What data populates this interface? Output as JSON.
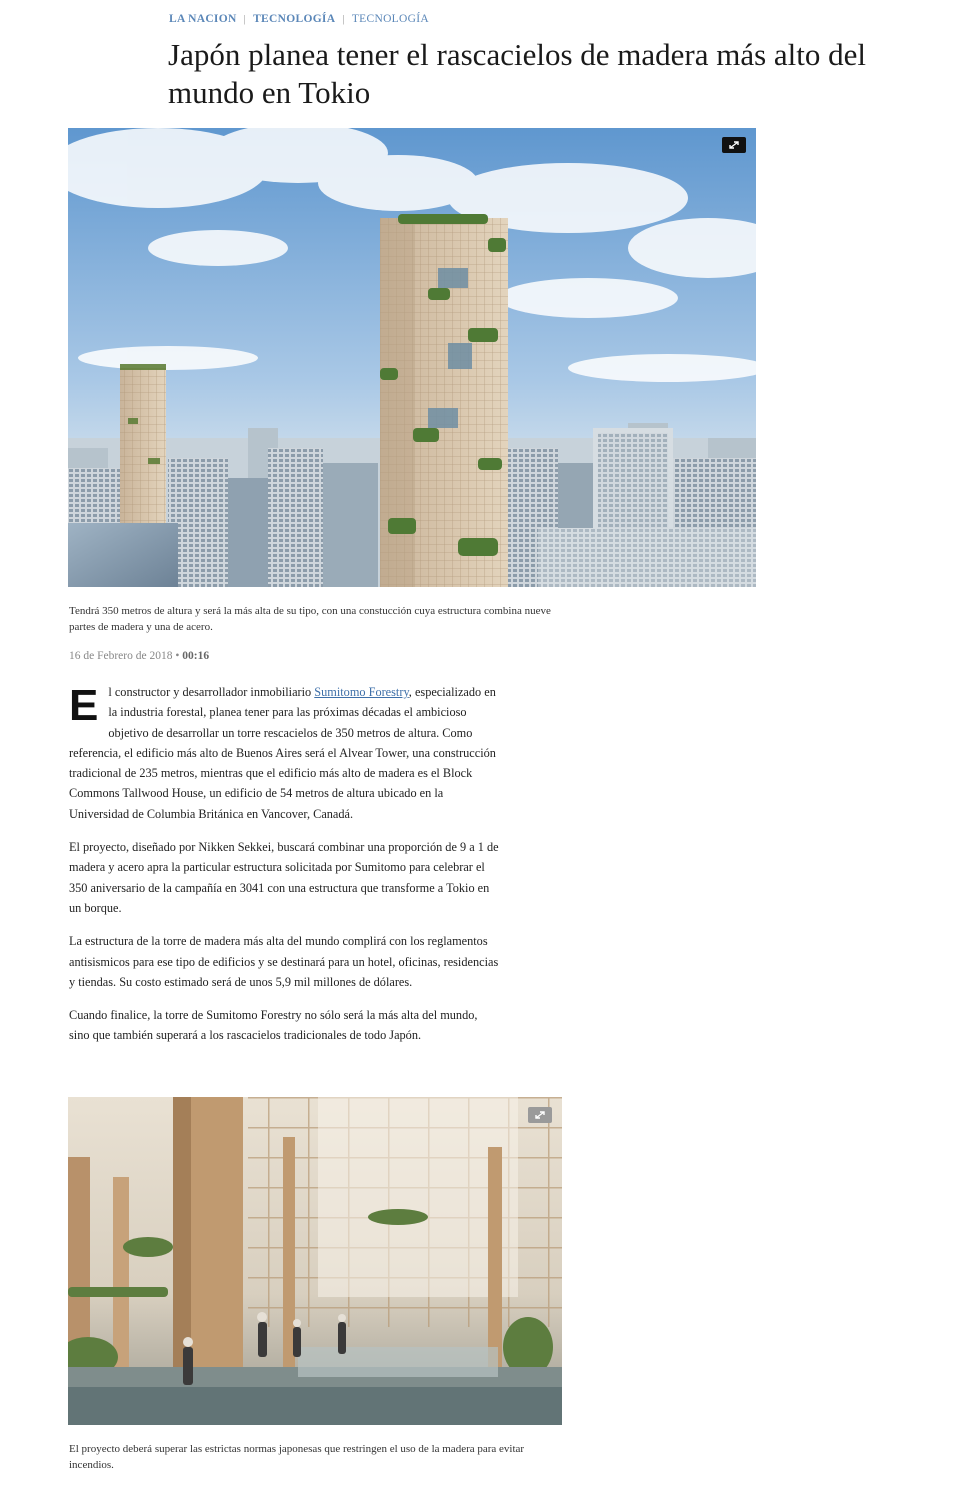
{
  "breadcrumb": {
    "site": "LA NACION",
    "section": "TECNOLOGÍA",
    "subsection": "Tecnología"
  },
  "article": {
    "title": "Japón planea tener el rascacielos de madera más alto del mundo en Tokio",
    "hero_caption": "Tendrá 350 metros de altura y será la más alta de su tipo, con una constucción cuya estructura combina nueve partes de madera y una de acero.",
    "date": "16 de Febrero de 2018",
    "date_sep": "•",
    "time": "00:16",
    "dropcap": "E",
    "p1_before_link": "l constructor y desarrollador inmobiliario ",
    "p1_link": "Sumitomo Forestry",
    "p1_after_link": ", especializado en la industria forestal, planea tener para las próximas décadas el ambicioso objetivo de desarrollar un torre rescacielos de 350 metros de altura. Como referencia, el edificio más alto de Buenos Aires será el Alvear Tower, una construcción tradicional de 235 metros, mientras que el edificio más alto de madera es el Block Commons Tallwood House, un edificio de 54 metros de altura ubicado en la Universidad de Columbia Británica en Vancover, Canadá.",
    "p2": "El proyecto, diseñado por Nikken Sekkei, buscará combinar una proporción de 9 a 1 de madera y acero apra la particular estructura solicitada por Sumitomo para celebrar el 350 aniversario de la campañía en 3041 con una estructura que transforme a Tokio en un borque.",
    "p3": "La estructura de la torre de madera más alta del mundo complirá con los reglamentos antisismicos para ese tipo de edificios y se destinará para un hotel, oficinas, residencias y tiendas. Su costo estimado será de unos 5,9 mil millones de dólares.",
    "p4": "Cuando finalice, la torre de Sumitomo Forestry no sólo será la más alta del mundo, sino que también superará a los rascacielos tradicionales de todo Japón.",
    "second_caption": "El proyecto deberá superar las estrictas normas japonesas que restringen el uso de la madera para evitar incendios."
  },
  "icons": {
    "expand": "expand-icon"
  },
  "colors": {
    "link": "#3e6fa8",
    "breadcrumb": "#5b87b8",
    "date": "#888888"
  }
}
